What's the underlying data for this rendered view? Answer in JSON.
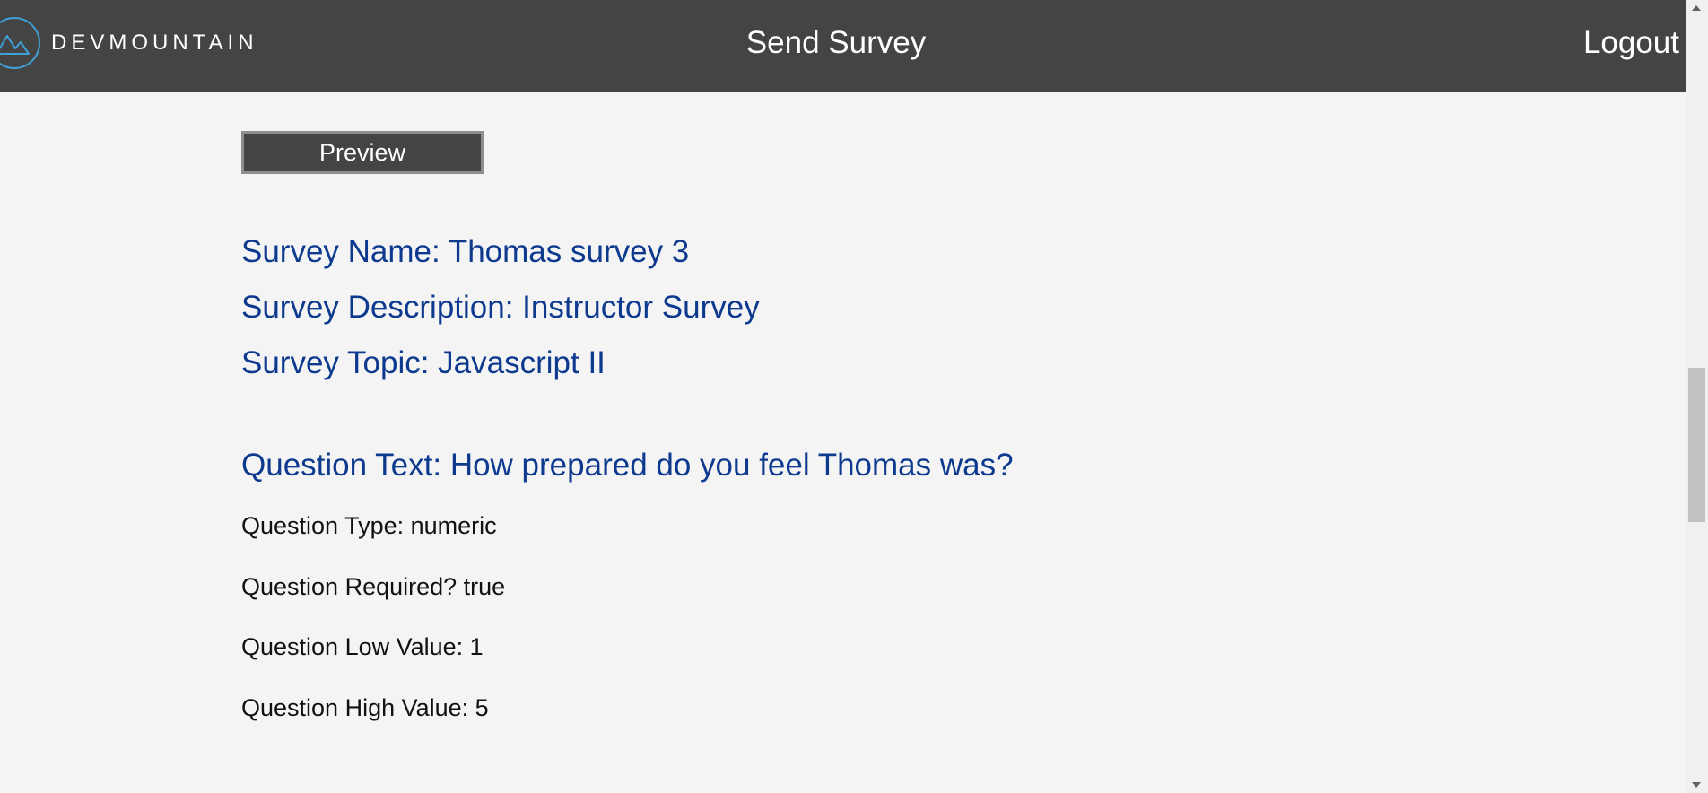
{
  "header": {
    "brand": "DEVMOUNTAIN",
    "title": "Send Survey",
    "logout_label": "Logout"
  },
  "preview": {
    "label": "Preview"
  },
  "survey": {
    "name": "Survey Name: Thomas survey 3",
    "description": "Survey Description: Instructor Survey",
    "topic": "Survey Topic: Javascript II"
  },
  "question": {
    "text": "Question Text: How prepared do you feel Thomas was?",
    "type": "Question Type: numeric",
    "required": "Question Required? true",
    "low_value": "Question Low Value: 1",
    "high_value": "Question High Value: 5"
  },
  "colors": {
    "header_bg": "#444444",
    "page_bg": "#f4f4f4",
    "survey_text": "#0d3a8e",
    "logo_accent": "#3ea1d8"
  },
  "icons": {
    "logo": "mountain-logo-icon",
    "scroll_up": "scroll-up-arrow-icon",
    "scroll_down": "scroll-down-arrow-icon"
  }
}
